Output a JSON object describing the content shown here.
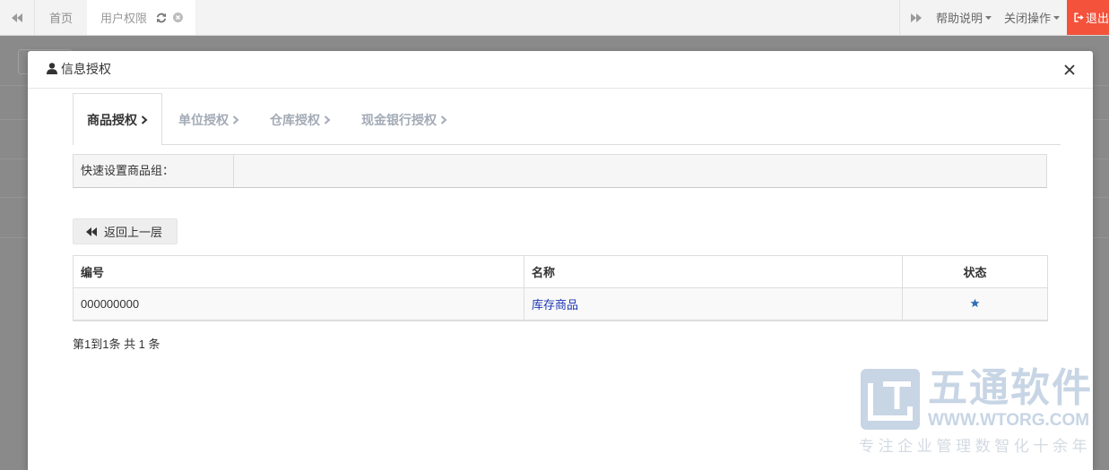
{
  "colors": {
    "backdrop": "#8a8a8a",
    "logout_bg": "#f4523b",
    "link": "#1e35b4",
    "star": "#2f6db5",
    "tab_inactive": "#a3abb6",
    "watermark": "#c7d5e5",
    "watermark_text": "#d3dae2"
  },
  "topbar": {
    "prev_icon": "double-left-icon",
    "tabs": [
      {
        "label": "首页",
        "active": false
      },
      {
        "label": "用户权限",
        "active": true,
        "icons": [
          "refresh-icon",
          "close-circle-icon"
        ]
      }
    ],
    "next_icon": "double-right-icon",
    "help": {
      "label": "帮助说明",
      "icon": "caret-down-icon"
    },
    "close_ops": {
      "label": "关闭操作",
      "icon": "caret-down-icon"
    },
    "logout": {
      "label": "退出",
      "icon": "logout-icon"
    }
  },
  "modal": {
    "title_icon": "user-icon",
    "title": "信息授权",
    "close_icon": "close-icon",
    "tabs": [
      {
        "label": "商品授权",
        "active": true,
        "icon": "chevron-right-icon"
      },
      {
        "label": "单位授权",
        "active": false,
        "icon": "chevron-right-icon"
      },
      {
        "label": "仓库授权",
        "active": false,
        "icon": "chevron-right-icon"
      },
      {
        "label": "现金银行授权",
        "active": false,
        "icon": "chevron-right-icon"
      }
    ],
    "quick_group": {
      "label": "快速设置商品组：",
      "value": ""
    },
    "back_button": {
      "label": "返回上一层",
      "icon": "backward-icon"
    },
    "table": {
      "columns": [
        "编号",
        "名称",
        "状态"
      ],
      "rows": [
        {
          "code": "000000000",
          "name": "库存商品",
          "status_icon": "star-icon"
        }
      ]
    },
    "pagination": "第1到1条 共 1 条"
  },
  "watermark": {
    "logo_icon": "wtorg-logo-icon",
    "brand": "五通软件",
    "site": "WWW.WTORG.COM",
    "slogan": "专注企业管理数智化十余年"
  }
}
